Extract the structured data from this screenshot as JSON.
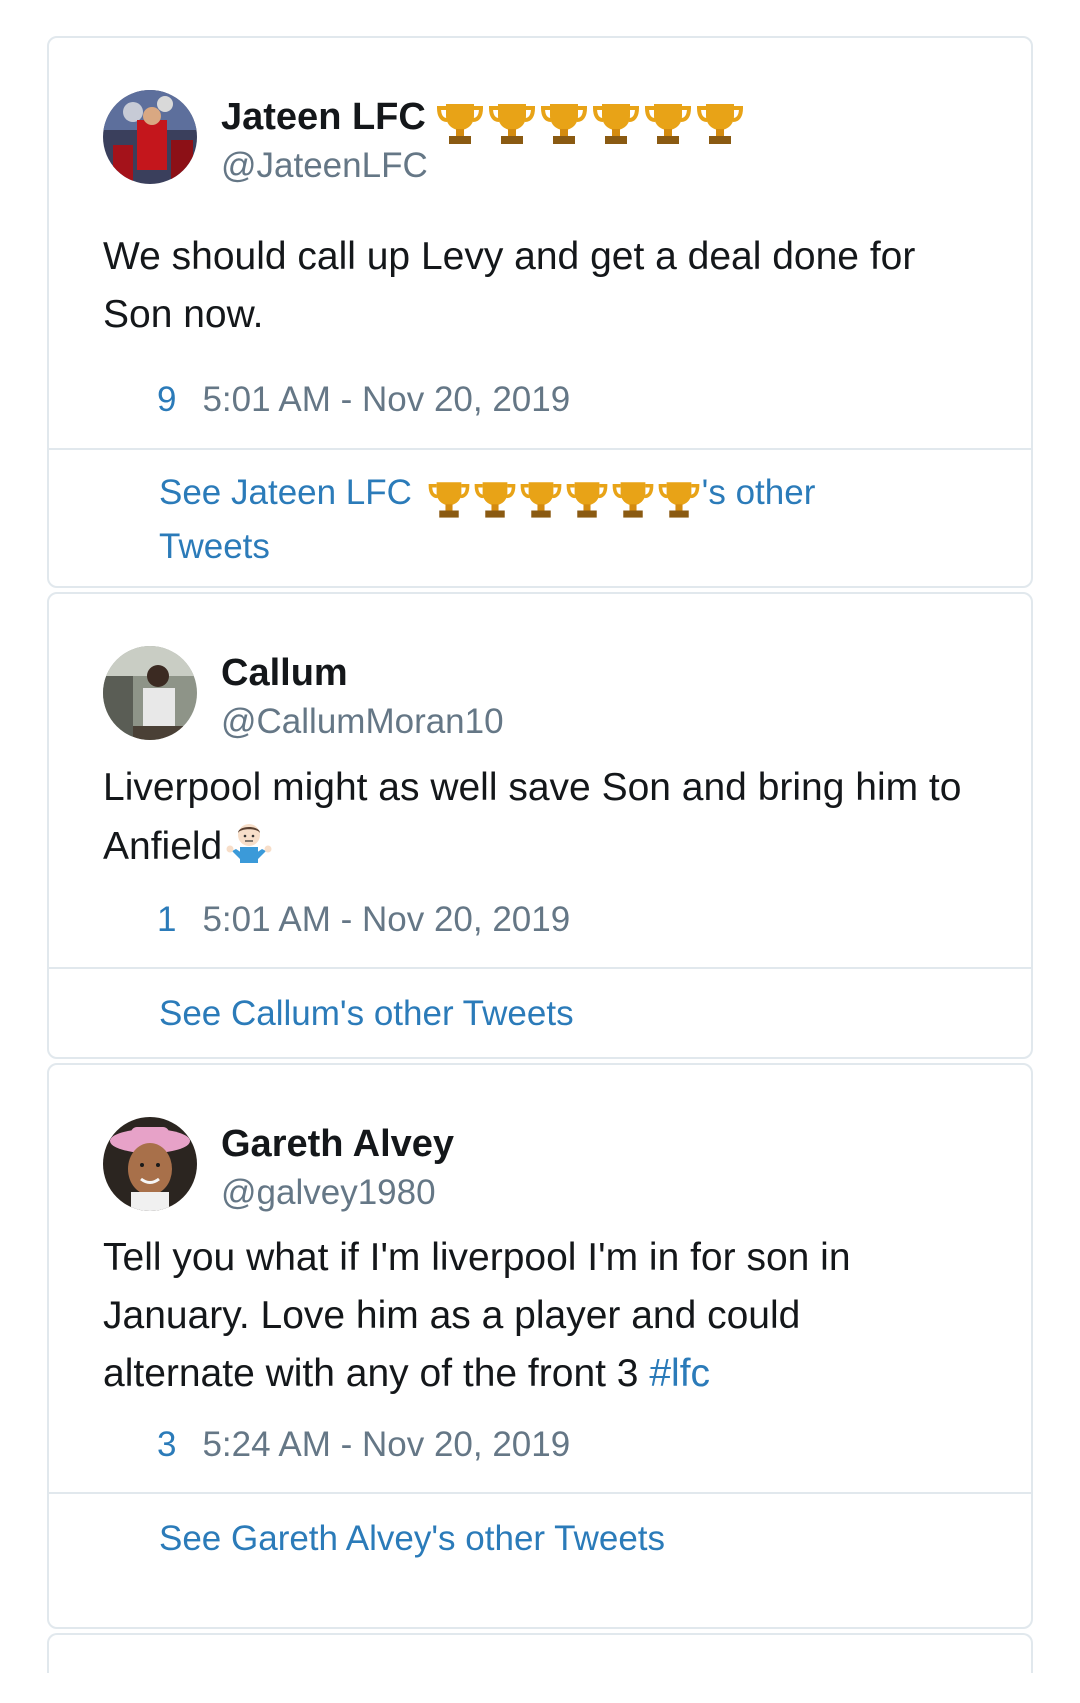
{
  "tweets": [
    {
      "name": "Jateen LFC",
      "handle": "@JateenLFC",
      "text": "We should call up Levy and get a deal done for Son now.",
      "likes": "9",
      "timestamp": "5:01 AM - Nov 20, 2019",
      "other_prefix": "See Jateen LFC",
      "other_suffix": "'s other",
      "other_end": "Tweets",
      "name_icons": [
        "trophy-icon",
        "trophy-icon",
        "trophy-icon",
        "trophy-icon",
        "trophy-icon",
        "trophy-icon"
      ]
    },
    {
      "name": "Callum",
      "handle": "@CallumMoran10",
      "text": "Liverpool might as well save Son and bring him to Anfield",
      "text_icon": "person-shrugging-icon",
      "likes": "1",
      "timestamp": "5:01 AM - Nov 20, 2019",
      "other_link": "See Callum's other Tweets"
    },
    {
      "name": "Gareth Alvey",
      "handle": "@galvey1980",
      "text": "Tell you what if I'm liverpool I'm in for son in January.  Love him as a player and could alternate with any of the front 3",
      "hashtag": "#lfc",
      "likes": "3",
      "timestamp": "5:24 AM - Nov 20, 2019",
      "other_link": "See Gareth Alvey's other Tweets"
    }
  ],
  "colors": {
    "link": "#2b7bb9",
    "text": "#14171a",
    "secondary": "#657786",
    "border": "#e1e8ed",
    "trophy": "#e8a317"
  }
}
